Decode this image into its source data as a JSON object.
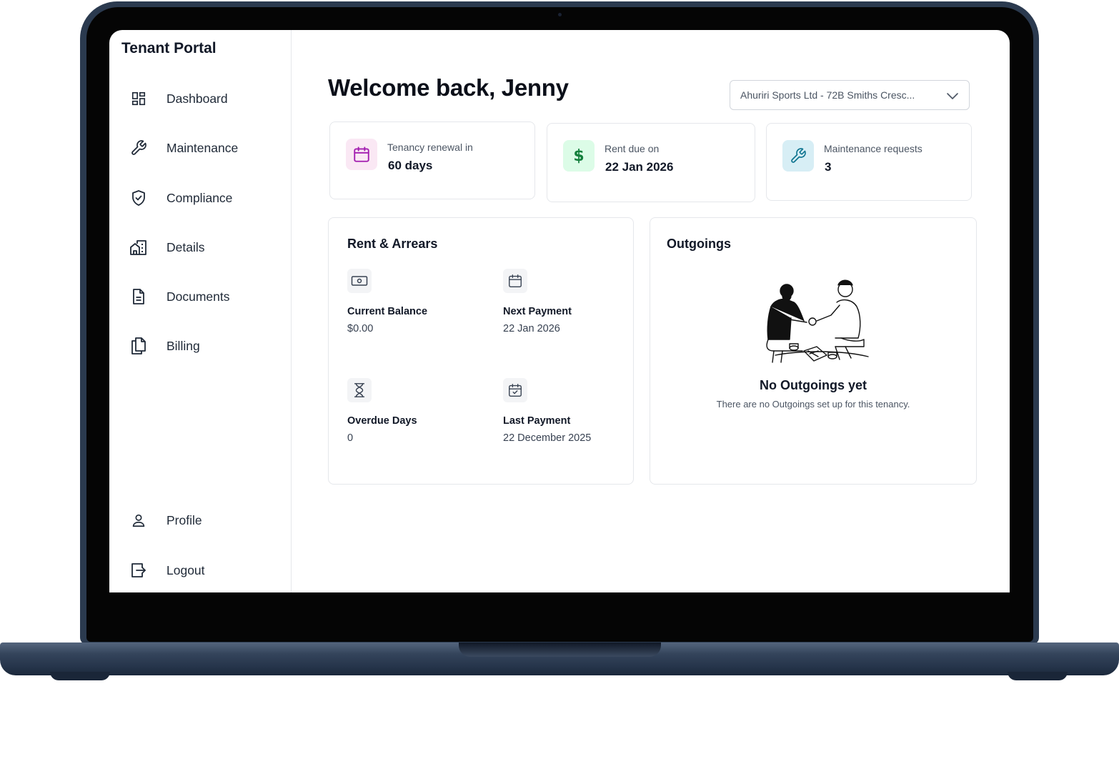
{
  "app": {
    "title": "Tenant Portal"
  },
  "sidebar": {
    "items": [
      {
        "label": "Dashboard",
        "icon": "dashboard-icon"
      },
      {
        "label": "Maintenance",
        "icon": "wrench-icon"
      },
      {
        "label": "Compliance",
        "icon": "shield-check-icon"
      },
      {
        "label": "Details",
        "icon": "building-icon"
      },
      {
        "label": "Documents",
        "icon": "document-icon"
      },
      {
        "label": "Billing",
        "icon": "copy-icon"
      }
    ],
    "footer": [
      {
        "label": "Profile",
        "icon": "user-icon"
      },
      {
        "label": "Logout",
        "icon": "logout-icon"
      }
    ]
  },
  "header": {
    "welcome": "Welcome back, Jenny",
    "property_select": {
      "value": "Ahuriri Sports Ltd - 72B Smiths Cresc..."
    }
  },
  "stats": [
    {
      "label": "Tenancy renewal in",
      "value": "60 days",
      "icon": "calendar-icon",
      "icon_color": "#a21caf",
      "icon_bg": "#fae8f4"
    },
    {
      "label": "Rent due on",
      "value": "22 Jan 2026",
      "icon": "dollar-icon",
      "icon_color": "#15803d",
      "icon_bg": "#dcfce7"
    },
    {
      "label": "Maintenance requests",
      "value": "3",
      "icon": "wrench-icon",
      "icon_color": "#0e7490",
      "icon_bg": "#d7eef5"
    }
  ],
  "rent": {
    "title": "Rent & Arrears",
    "metrics": [
      {
        "label": "Current Balance",
        "value": "$0.00",
        "icon": "cash-icon"
      },
      {
        "label": "Next Payment",
        "value": "22 Jan 2026",
        "icon": "calendar-icon"
      },
      {
        "label": "Overdue Days",
        "value": "0",
        "icon": "hourglass-icon"
      },
      {
        "label": "Last Payment",
        "value": "22 December 2025",
        "icon": "calendar-check-icon"
      }
    ]
  },
  "outgoings": {
    "title": "Outgoings",
    "empty_title": "No Outgoings yet",
    "empty_text": "There are no Outgoings set up for this tenancy."
  }
}
